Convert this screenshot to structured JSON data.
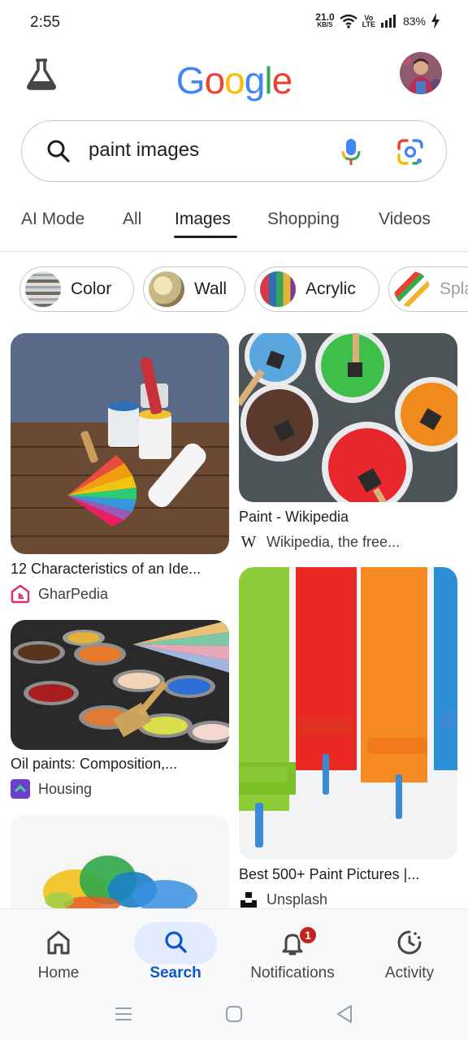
{
  "status_bar": {
    "time": "2:55",
    "net_speed_value": "21.0",
    "net_speed_unit": "KB/S",
    "volte_top": "Vo",
    "volte_bottom": "LTE",
    "battery_percent": "83%"
  },
  "header": {
    "logo_letters": [
      {
        "char": "G",
        "color": "#4285F4"
      },
      {
        "char": "o",
        "color": "#EA4335"
      },
      {
        "char": "o",
        "color": "#FBBC05"
      },
      {
        "char": "g",
        "color": "#4285F4"
      },
      {
        "char": "l",
        "color": "#34A853"
      },
      {
        "char": "e",
        "color": "#EA4335"
      }
    ]
  },
  "search": {
    "query": "paint images"
  },
  "tabs": [
    {
      "label": "AI Mode",
      "active": false
    },
    {
      "label": "All",
      "active": false
    },
    {
      "label": "Images",
      "active": true
    },
    {
      "label": "Shopping",
      "active": false
    },
    {
      "label": "Videos",
      "active": false
    }
  ],
  "chips": [
    {
      "label": "Color"
    },
    {
      "label": "Wall"
    },
    {
      "label": "Acrylic"
    },
    {
      "label": "Spla"
    }
  ],
  "results": [
    {
      "title": "12 Characteristics of an Ide...",
      "source": "GharPedia"
    },
    {
      "title": "Paint - Wikipedia",
      "source": "Wikipedia, the free..."
    },
    {
      "title": "Oil paints: Composition,...",
      "source": "Housing"
    },
    {
      "title": "Best 500+ Paint Pictures |...",
      "source": "Unsplash"
    }
  ],
  "source_icon_letters": {
    "wikipedia": "W"
  },
  "bottom_nav": [
    {
      "label": "Home",
      "active": false
    },
    {
      "label": "Search",
      "active": true
    },
    {
      "label": "Notifications",
      "active": false,
      "badge": "1"
    },
    {
      "label": "Activity",
      "active": false
    }
  ],
  "colors": {
    "accent_blue": "#0b57d0",
    "active_pill": "#e3ecfd",
    "badge_red": "#c5221f"
  }
}
